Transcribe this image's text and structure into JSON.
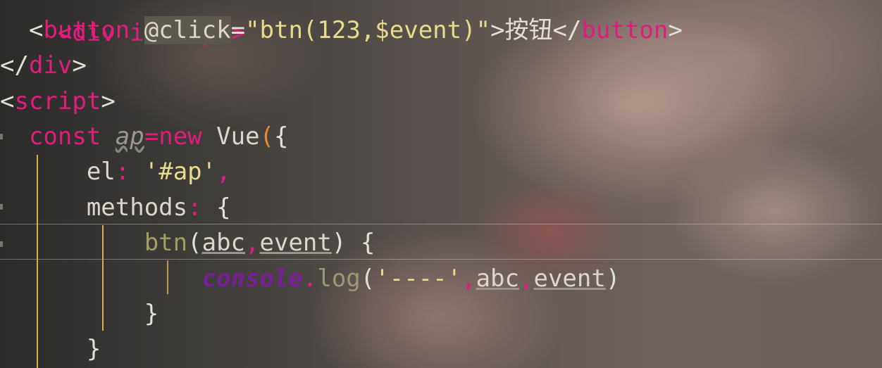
{
  "editor": {
    "line0": "<div id=\"ap\">",
    "line1": {
      "indent": "  ",
      "open_bracket": "<",
      "tag": "button",
      "space": " ",
      "attr": "@click",
      "eq": "=",
      "value": "\"btn(123,$event)\"",
      "close_bracket": ">",
      "text": "按钮",
      "end_open": "</",
      "end_tag": "button",
      "end_close": ">"
    },
    "line2": {
      "open": "</",
      "tag": "div",
      "close": ">"
    },
    "line3": {
      "open": "<",
      "tag": "script",
      "close": ">"
    },
    "line4": {
      "indent": "  ",
      "kw_const": "const",
      "space": " ",
      "ident": "ap",
      "eq": "=",
      "kw_new": "new",
      "space2": " ",
      "cls": "Vue",
      "paren": "(",
      "brace": "{"
    },
    "line5": {
      "indent": "      ",
      "prop": "el",
      "colon": ":",
      "space": " ",
      "value": "'#ap'",
      "comma": ","
    },
    "line6": {
      "indent": "      ",
      "prop": "methods",
      "colon": ":",
      "space": " ",
      "brace": "{"
    },
    "line7": {
      "indent": "          ",
      "fn": "btn",
      "paren_open": "(",
      "param1": "abc",
      "comma": ",",
      "param2": "event",
      "paren_close": ")",
      "space": " ",
      "brace": "{"
    },
    "line8": {
      "indent": "              ",
      "console": "console",
      "dot": ".",
      "log": "log",
      "paren_open": "(",
      "str": "'----'",
      "comma1": ",",
      "arg1": "abc",
      "comma2": ",",
      "arg2": "event",
      "paren_close": ")"
    },
    "line9": {
      "indent": "          ",
      "brace": "}"
    },
    "line10": {
      "indent": "      ",
      "brace": "}"
    }
  }
}
